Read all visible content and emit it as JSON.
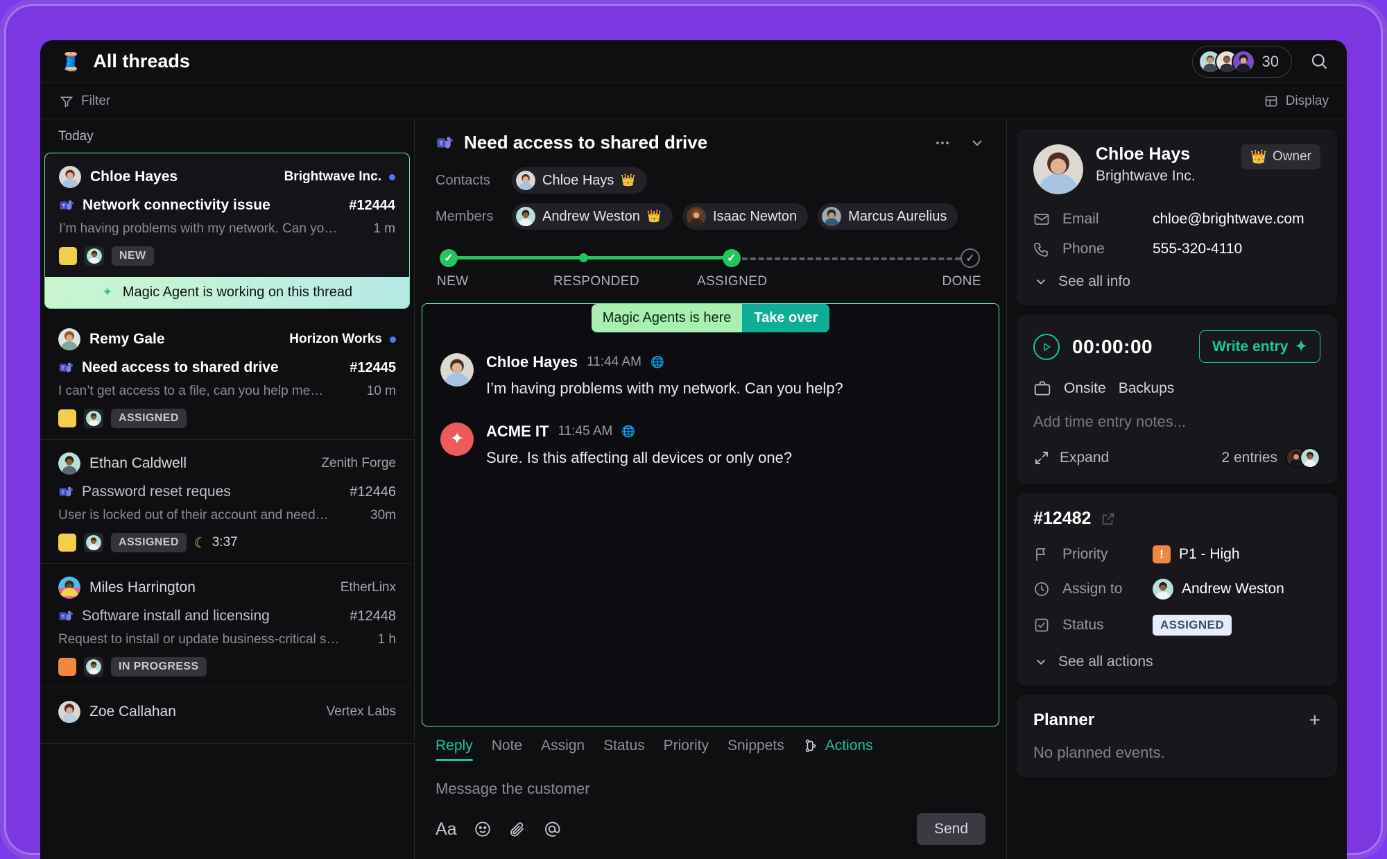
{
  "topbar": {
    "icon": "thread-spool-icon",
    "title": "All threads",
    "member_count": "30",
    "search_icon": "search-icon"
  },
  "filterbar": {
    "filter_label": "Filter",
    "filter_icon": "funnel-icon",
    "display_label": "Display",
    "display_icon": "layout-icon"
  },
  "threadlist": {
    "day_label": "Today",
    "magic_agent_banner": "Magic Agent is working on this thread",
    "threads": [
      {
        "name": "Chloe Hayes",
        "org": "Brightwave Inc.",
        "subject": "Network connectivity issue",
        "number": "#12444",
        "preview": "I’m having problems with my network. Can yo…",
        "time": "1 m",
        "status": "NEW",
        "priority_color": "#f2cf4a",
        "unread": true,
        "timer": ""
      },
      {
        "name": "Remy Gale",
        "org": "Horizon Works",
        "subject": "Need access to shared drive",
        "number": "#12445",
        "preview": "I can’t get access to a file, can you help me…",
        "time": "10 m",
        "status": "ASSIGNED",
        "priority_color": "#f2cf4a",
        "unread": true,
        "timer": ""
      },
      {
        "name": "Ethan Caldwell",
        "org": "Zenith Forge",
        "subject": "Password reset reques",
        "number": "#12446",
        "preview": "User is locked out of their account and need…",
        "time": "30m",
        "status": "ASSIGNED",
        "priority_color": "#f2cf4a",
        "unread": false,
        "timer": "3:37"
      },
      {
        "name": "Miles Harrington",
        "org": "EtherLinx",
        "subject": "Software install and licensing",
        "number": "#12448",
        "preview": "Request to install or update business-critical s…",
        "time": "1 h",
        "status": "IN PROGRESS",
        "priority_color": "#f0883e",
        "unread": false,
        "timer": ""
      },
      {
        "name": "Zoe Callahan",
        "org": "Vertex Labs",
        "subject": "",
        "number": "",
        "preview": "",
        "time": "",
        "status": "",
        "priority_color": "#f2cf4a",
        "unread": false,
        "timer": ""
      }
    ]
  },
  "conversation": {
    "title": "Need access to shared drive",
    "channel_icon": "microsoft-teams-icon",
    "more_icon": "more-horizontal-icon",
    "collapse_icon": "chevron-down-icon",
    "contacts_label": "Contacts",
    "contacts": [
      {
        "name": "Chloe Hays",
        "owner": true
      }
    ],
    "members_label": "Members",
    "members": [
      {
        "name": "Andrew Weston",
        "owner": true
      },
      {
        "name": "Isaac Newton",
        "owner": false
      },
      {
        "name": "Marcus Aurelius",
        "owner": false
      }
    ],
    "tracker": {
      "steps": [
        "NEW",
        "RESPONDED",
        "ASSIGNED",
        "DONE"
      ],
      "completed_through": "ASSIGNED",
      "active_color": "#22c55e",
      "pending_color": "#5c5c66"
    },
    "takeover": {
      "text": "Magic Agents is here",
      "button": "Take over"
    },
    "messages": [
      {
        "author": "Chloe Hayes",
        "time": "11:44 AM",
        "text": "I’m having problems with my network. Can you help?",
        "is_bot": false
      },
      {
        "author": "ACME IT",
        "time": "11:45 AM",
        "text": "Sure. Is this affecting all devices or only one?",
        "is_bot": true
      }
    ],
    "composer": {
      "tabs": [
        "Reply",
        "Note",
        "Assign",
        "Status",
        "Priority",
        "Snippets"
      ],
      "active_tab": "Reply",
      "actions_label": "Actions",
      "actions_icon": "workflow-icon",
      "placeholder": "Message the customer",
      "tools": [
        "Aa",
        "emoji-icon",
        "attachment-icon",
        "mention-icon"
      ],
      "send_label": "Send"
    }
  },
  "sidebar": {
    "contact": {
      "name": "Chloe Hays",
      "org": "Brightwave Inc.",
      "owner_badge": "Owner",
      "email_label": "Email",
      "email_value": "chloe@brightwave.com",
      "phone_label": "Phone",
      "phone_value": "555-320-4110",
      "see_all": "See all info"
    },
    "timer": {
      "value": "00:00:00",
      "write_entry": "Write entry",
      "tags": [
        "Onsite",
        "Backups"
      ],
      "notes_placeholder": "Add time entry notes...",
      "expand_label": "Expand",
      "entries_count": "2 entries"
    },
    "ticket": {
      "id": "#12482",
      "open_icon": "external-link-icon",
      "priority_label": "Priority",
      "priority_value": "P1 - High",
      "priority_color": "#f0883e",
      "assign_label": "Assign to",
      "assign_value": "Andrew Weston",
      "status_label": "Status",
      "status_value": "ASSIGNED",
      "see_all_actions": "See all actions"
    },
    "planner": {
      "title": "Planner",
      "add_icon": "plus-icon",
      "empty": "No planned events."
    }
  }
}
